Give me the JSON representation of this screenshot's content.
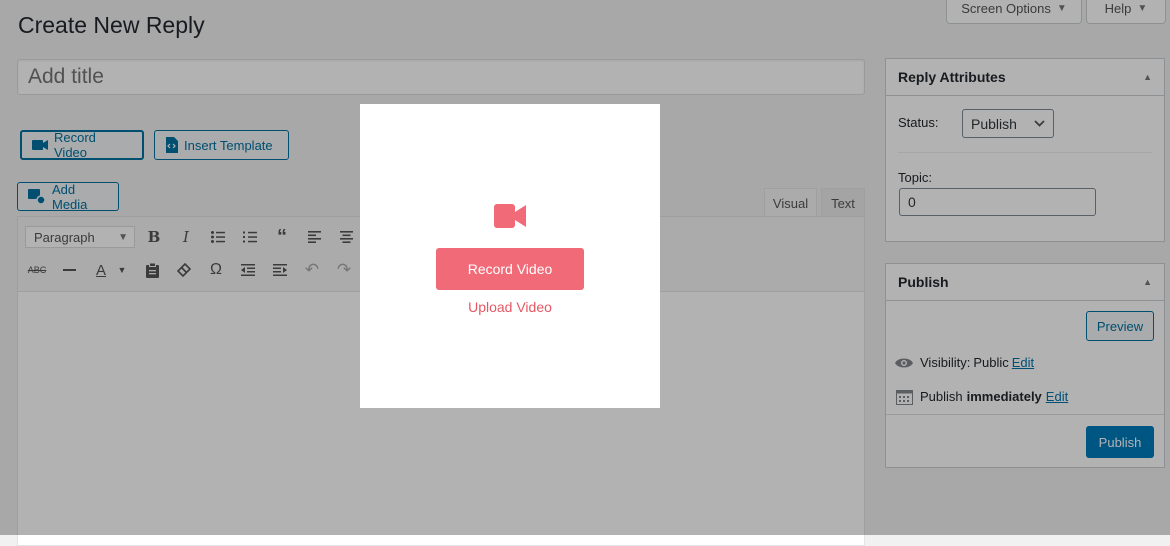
{
  "page": {
    "title": "Create New Reply",
    "title_placeholder": "Add title"
  },
  "screen_meta": {
    "screen_options": "Screen Options",
    "help": "Help"
  },
  "toolbar_buttons": {
    "record_video": "Record Video",
    "insert_template": "Insert Template",
    "add_media": "Add Media"
  },
  "editor": {
    "tabs": [
      "Visual",
      "Text"
    ],
    "format_select": "Paragraph",
    "row1_icons": [
      "bold-icon",
      "italic-icon",
      "bullet-list-icon",
      "numbered-list-icon",
      "blockquote-icon",
      "align-left-icon",
      "align-center-icon"
    ],
    "row2_icons": [
      "strikethrough-icon",
      "horizontal-line-icon",
      "text-color-icon",
      "paste-text-icon",
      "clear-formatting-icon",
      "special-character-icon",
      "outdent-icon",
      "indent-icon",
      "undo-icon",
      "redo-icon"
    ]
  },
  "reply_attributes": {
    "heading": "Reply Attributes",
    "status_label": "Status:",
    "status_value": "Publish",
    "topic_label": "Topic:",
    "topic_value": "0"
  },
  "publish_box": {
    "heading": "Publish",
    "preview": "Preview",
    "visibility_label": "Visibility:",
    "visibility_value": "Public",
    "edit": "Edit",
    "publish_label": "Publish",
    "publish_when": "immediately",
    "publish_button": "Publish"
  },
  "modal": {
    "icon": "video-camera-icon",
    "record_button": "Record Video",
    "upload_link": "Upload Video",
    "accent_color": "#f06a78"
  }
}
